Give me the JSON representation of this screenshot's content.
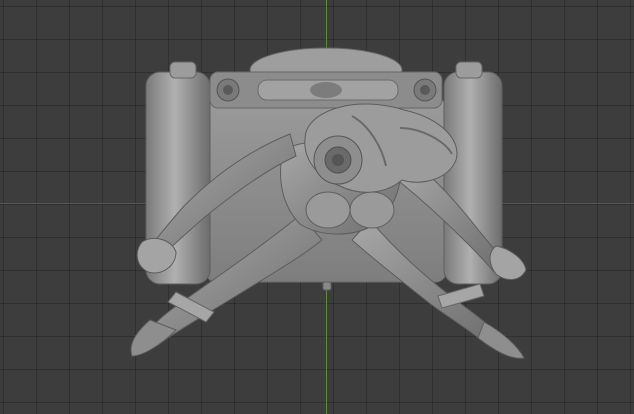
{
  "viewport": {
    "background_color": "#3d3d3d",
    "grid_color": "#333333",
    "x_axis_color": "#8f3a45",
    "y_axis_color": "#5f8a2a"
  },
  "model": {
    "mesh_color": "#8a8a8a",
    "shade_dark": "#5c5c5c",
    "shade_light": "#b4b4b4"
  }
}
